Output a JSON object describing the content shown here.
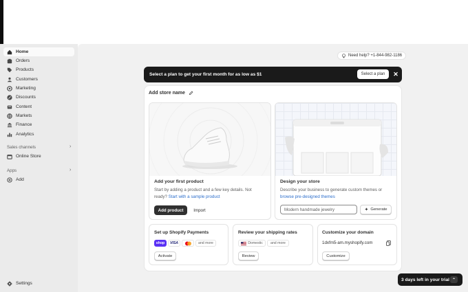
{
  "sidebar": {
    "items": [
      {
        "label": "Home"
      },
      {
        "label": "Orders"
      },
      {
        "label": "Products"
      },
      {
        "label": "Customers"
      },
      {
        "label": "Marketing"
      },
      {
        "label": "Discounts"
      },
      {
        "label": "Content"
      },
      {
        "label": "Markets"
      },
      {
        "label": "Finance"
      },
      {
        "label": "Analytics"
      }
    ],
    "sales_channels_label": "Sales channels",
    "online_store_label": "Online Store",
    "apps_label": "Apps",
    "add_label": "Add",
    "settings_label": "Settings"
  },
  "header": {
    "help_text": "Need help? +1-844-982-1186"
  },
  "banner": {
    "text": "Select a plan to get your first month for as low as $1",
    "button_label": "Select a plan",
    "close_glyph": "✕"
  },
  "store": {
    "name_label": "Add store name"
  },
  "product_panel": {
    "title": "Add your first product",
    "description": "Start by adding a product and a few key details. Not ready?",
    "link_text": "Start with a sample product",
    "primary_button": "Add product",
    "secondary_button": "Import"
  },
  "design_panel": {
    "title": "Design your store",
    "description": "Describe your business to generate custom themes or",
    "link_text": "browse pre-designed themes",
    "input_placeholder": "Modern handmade jewelry",
    "generate_button": "Generate"
  },
  "payments_panel": {
    "title": "Set up Shopify Payments",
    "chips": [
      "shop",
      "VISA",
      "",
      "and more"
    ],
    "button": "Activate"
  },
  "shipping_panel": {
    "title": "Review your shipping rates",
    "chips": [
      "Domestic",
      "and more"
    ],
    "button": "Review"
  },
  "domain_panel": {
    "title": "Customize your domain",
    "domain": "1dxfm5-am.myshopify.com",
    "button": "Customize"
  },
  "trial": {
    "text": "3 days left in your trial",
    "chevron": "⌃"
  },
  "colors": {
    "banner_bg": "#1a1a1a",
    "link": "#2c6ecb",
    "shop_pay": "#5a31f4",
    "trial_bg": "#1a1a1a"
  }
}
